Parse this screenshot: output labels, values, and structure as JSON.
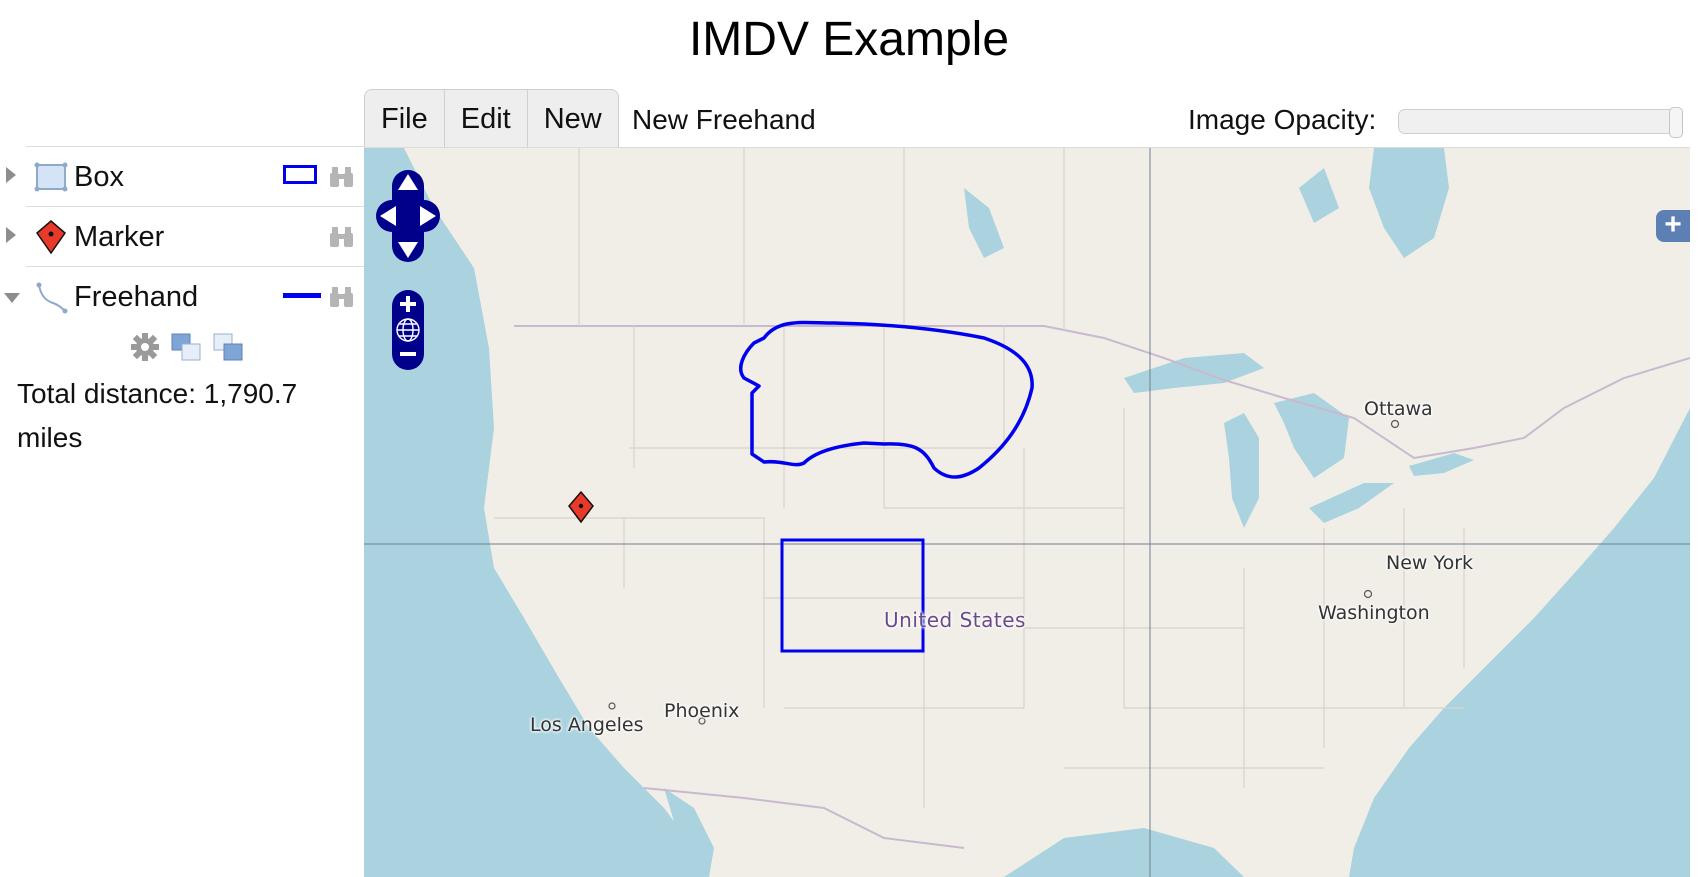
{
  "title": "IMDV Example",
  "menu": {
    "items": [
      "File",
      "Edit",
      "New"
    ]
  },
  "toolbar": {
    "current_tool": "New Freehand",
    "opacity_label": "Image Opacity:",
    "opacity_value": 1.0
  },
  "layers": [
    {
      "label": "Box",
      "icon": "box-icon",
      "expanded": false,
      "style": "box-outline",
      "style_color": "#0000ee"
    },
    {
      "label": "Marker",
      "icon": "marker-icon",
      "expanded": false,
      "style": "none",
      "style_color": "#e8392b"
    },
    {
      "label": "Freehand",
      "icon": "freehand-icon",
      "expanded": true,
      "style": "line",
      "style_color": "#0000ee"
    }
  ],
  "sidebar_tools": [
    "gear-icon",
    "layers-back-icon",
    "layers-front-icon"
  ],
  "measurement": {
    "text": "Total distance: 1,790.7 miles"
  },
  "map": {
    "labels": {
      "ottawa": "Ottawa",
      "new_york": "New York",
      "washington": "Washington",
      "united_states": "United States",
      "phoenix": "Phoenix",
      "los_angeles": "Los Angeles"
    },
    "land_color": "#f1eee8",
    "water_color": "#aad3df",
    "feature_color": "#0000ee",
    "marker_color": "#e8392b",
    "controls": [
      "pan-up-button",
      "pan-left-button",
      "pan-right-button",
      "pan-down-button",
      "zoom-in-button",
      "zoom-world-button",
      "zoom-out-button",
      "layer-switcher-button"
    ]
  }
}
